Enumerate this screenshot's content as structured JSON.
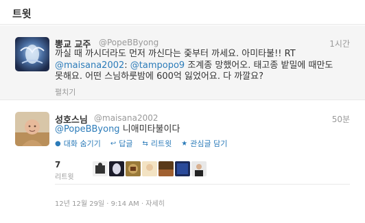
{
  "page": {
    "title": "트윗"
  },
  "tweet1": {
    "name": "뽕교 교주",
    "handle": "@PopeBByong",
    "time": "1시간",
    "text_plain1": "까실 때 까시더라도 먼저 까신다는 줒부터 까세요. 아미타불!! RT",
    "mention1": "@maisana2002",
    "colon1": ": ",
    "mention2": "@tampopo9",
    "text_plain2": " 조계종 망했어오. 태고종 밭밀에 때만도",
    "line3": "못해요. 어떤 스님하룻밤에 600억 잃었어요. 다 까깔요?",
    "expand_label": "펼치기"
  },
  "tweet2": {
    "name": "성호스님",
    "handle": "@maisana2002",
    "time": "50분",
    "mention": "@PopeBByong",
    "text_plain": " 니애미타불이다",
    "actions": {
      "conversation": "대화 숨기기",
      "reply": "답글",
      "retweet": "리트윗",
      "favorite": "관심글 담기"
    },
    "retweet_count": "7",
    "retweet_label": "리트윗",
    "timestamp": "12년 12월 29일 · 9:14 AM · 자세히"
  },
  "colors": {
    "link": "#2b7bb9",
    "muted": "#999999",
    "text": "#333333",
    "highlight_bg": "#f5f5f5"
  },
  "icons": [
    "conversation-icon",
    "reply-icon",
    "retweet-icon",
    "favorite-star-icon"
  ]
}
